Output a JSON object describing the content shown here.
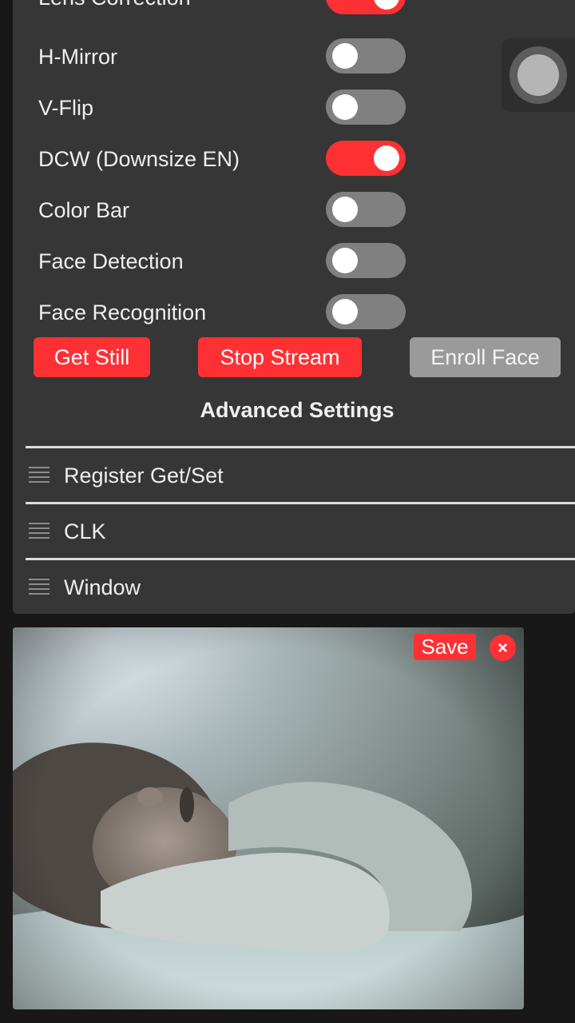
{
  "settings": {
    "toggles": [
      {
        "label": "Lens Correction",
        "on": true
      },
      {
        "label": "H-Mirror",
        "on": false
      },
      {
        "label": "V-Flip",
        "on": false
      },
      {
        "label": "DCW (Downsize EN)",
        "on": true
      },
      {
        "label": "Color Bar",
        "on": false
      },
      {
        "label": "Face Detection",
        "on": false
      },
      {
        "label": "Face Recognition",
        "on": false
      }
    ],
    "buttons": {
      "get_still": "Get Still",
      "stop_stream": "Stop Stream",
      "enroll_face": "Enroll Face"
    },
    "advanced_title": "Advanced Settings",
    "sections": [
      {
        "label": "Register Get/Set"
      },
      {
        "label": "CLK"
      },
      {
        "label": "Window"
      }
    ]
  },
  "stream": {
    "save_label": "Save",
    "close_label": "×"
  },
  "icons": {
    "section_icon": "hamburger-icon",
    "floating_icon": "record-circle-icon"
  },
  "colors": {
    "accent": "#ff3034",
    "panel": "#363636",
    "background": "#181818",
    "toggle_off": "#808080",
    "disabled_button": "#9a9a9a"
  }
}
